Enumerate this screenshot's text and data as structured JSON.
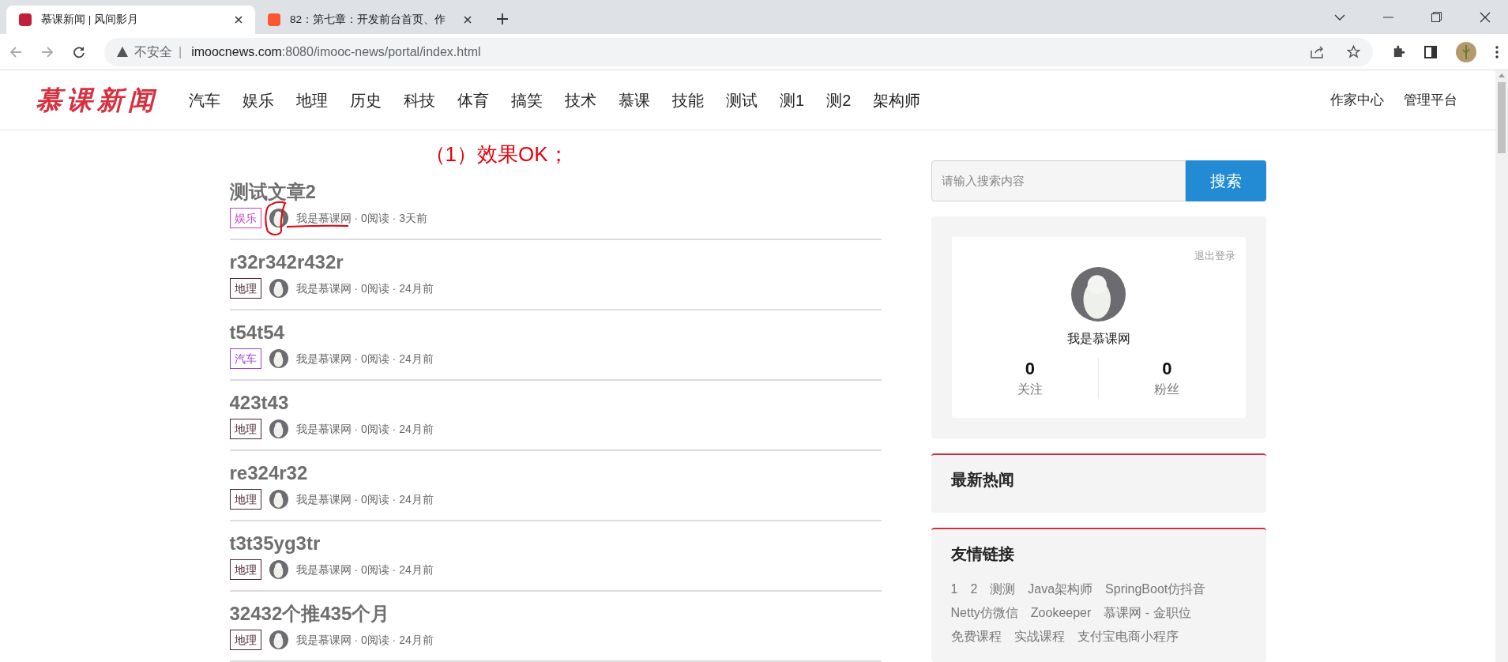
{
  "browser": {
    "tabs": [
      {
        "title": "慕课新闻 | 风间影月",
        "selected": true,
        "kind": "site"
      },
      {
        "title": "82：第七章：开发前台首页、作",
        "selected": false,
        "kind": "csdn"
      }
    ],
    "address": {
      "security": "不安全",
      "separator": "|",
      "url_host": "imoocnews.com",
      "url_rest": ":8080/imooc-news/portal/index.html"
    }
  },
  "site": {
    "logo": "慕课新闻",
    "nav": [
      "汽车",
      "娱乐",
      "地理",
      "历史",
      "科技",
      "体育",
      "搞笑",
      "技术",
      "慕课",
      "技能",
      "测试",
      "测1",
      "测2",
      "架构师"
    ],
    "right_links": [
      "作家中心",
      "管理平台"
    ]
  },
  "annotation": "（1）效果OK；",
  "articles": [
    {
      "title": "测试文章2",
      "tag": "娱乐",
      "color": "#c33fc3",
      "author": "我是慕课网",
      "meta": " · 0阅读 · 3天前",
      "annotated": true
    },
    {
      "title": "r32r342r432r",
      "tag": "地理",
      "color": "#4b2333",
      "author": "我是慕课网",
      "meta": " · 0阅读 · 24月前",
      "annotated": false
    },
    {
      "title": "t54t54",
      "tag": "汽车",
      "color": "#9a40d0",
      "author": "我是慕课网",
      "meta": " · 0阅读 · 24月前",
      "annotated": false
    },
    {
      "title": "423t43",
      "tag": "地理",
      "color": "#4b2333",
      "author": "我是慕课网",
      "meta": " · 0阅读 · 24月前",
      "annotated": false
    },
    {
      "title": "re324r32",
      "tag": "地理",
      "color": "#4b2333",
      "author": "我是慕课网",
      "meta": " · 0阅读 · 24月前",
      "annotated": false
    },
    {
      "title": "t3t35yg3tr",
      "tag": "地理",
      "color": "#4b2333",
      "author": "我是慕课网",
      "meta": " · 0阅读 · 24月前",
      "annotated": false
    },
    {
      "title": "32432个推435个月",
      "tag": "地理",
      "color": "#4b2333",
      "author": "我是慕课网",
      "meta": " · 0阅读 · 24月前",
      "annotated": false
    }
  ],
  "sidebar": {
    "search": {
      "placeholder": "请输入搜索内容",
      "button": "搜索"
    },
    "profile": {
      "logout": "退出登录",
      "name": "我是慕课网",
      "stats": [
        {
          "value": "0",
          "label": "关注"
        },
        {
          "value": "0",
          "label": "粉丝"
        }
      ]
    },
    "hot_news": {
      "title": "最新热闻"
    },
    "links": {
      "title": "友情链接",
      "items": [
        "1",
        "2",
        "测测",
        "Java架构师",
        "SpringBoot仿抖音",
        "Netty仿微信",
        "Zookeeper",
        "慕课网 - 金职位",
        "免费课程",
        "实战课程",
        "支付宝电商小程序"
      ]
    }
  }
}
